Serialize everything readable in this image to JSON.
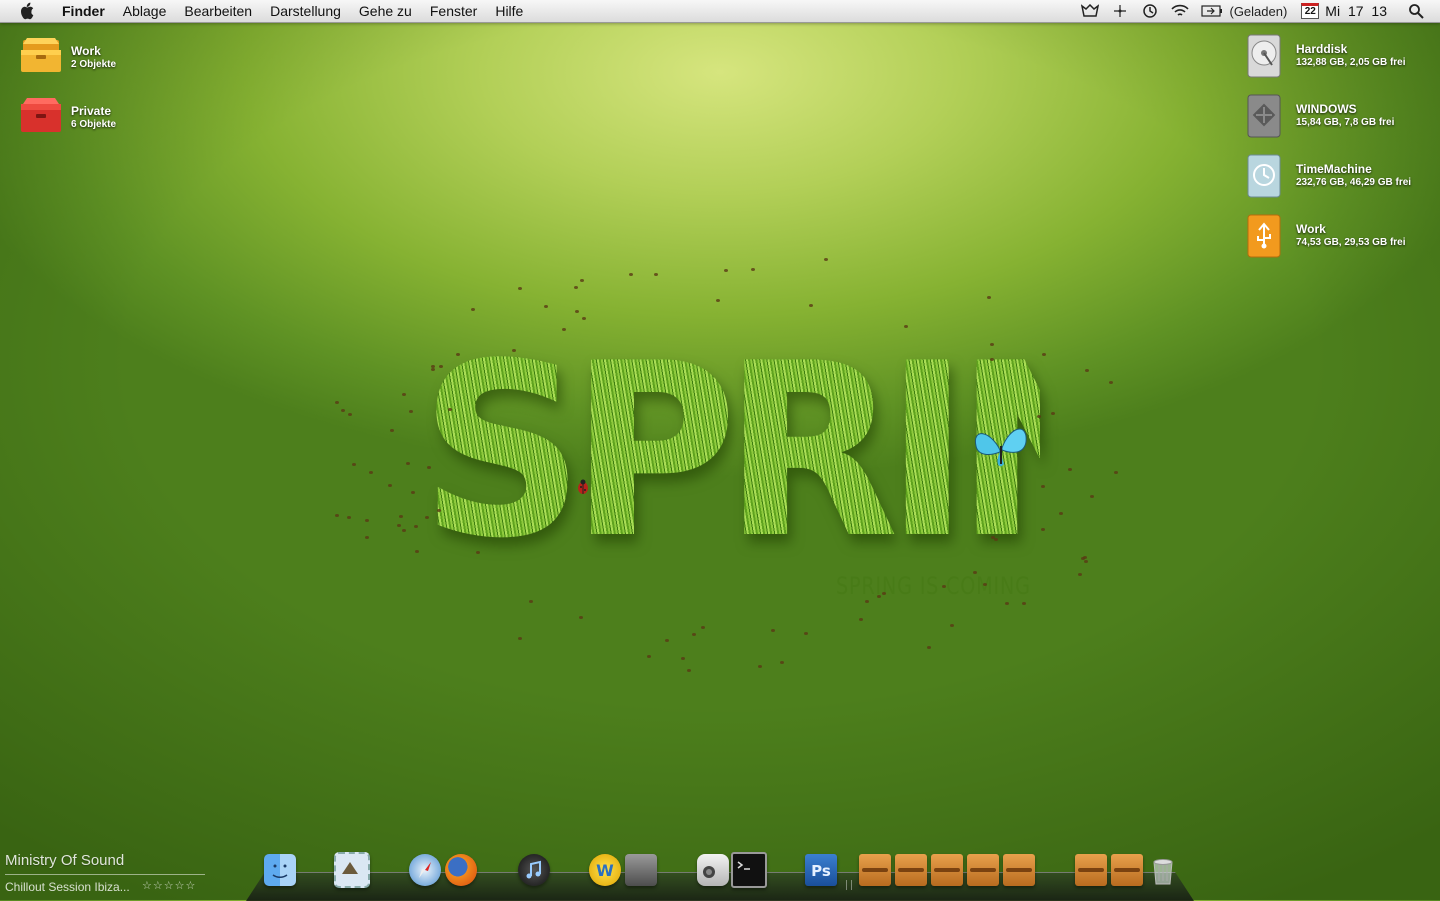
{
  "menubar": {
    "apple_icon": "apple-icon",
    "items": [
      "Finder",
      "Ablage",
      "Bearbeiten",
      "Darstellung",
      "Gehe zu",
      "Fenster",
      "Hilfe"
    ],
    "status": {
      "battery_label": "(Geladen)",
      "calendar_day": "22",
      "clock": "Mi  17 13"
    }
  },
  "desktop_left": [
    {
      "name": "Work",
      "sub": "2 Objekte",
      "color": "#f2b531"
    },
    {
      "name": "Private",
      "sub": "6 Objekte",
      "color": "#d8312c"
    }
  ],
  "desktop_right": [
    {
      "name": "Harddisk",
      "sub": "132,88 GB, 2,05 GB frei"
    },
    {
      "name": "WINDOWS",
      "sub": "15,84 GB, 7,8 GB frei"
    },
    {
      "name": "TimeMachine",
      "sub": "232,76 GB, 46,29 GB frei"
    },
    {
      "name": "Work",
      "sub": "74,53 GB, 29,53 GB frei"
    }
  ],
  "wallpaper": {
    "title": "SPRING",
    "subtitle": "SPRING IS COMING"
  },
  "itunes": {
    "artist": "Ministry Of Sound",
    "album": "Chillout Session Ibiza...",
    "stars": "☆☆☆☆☆"
  },
  "dock": {
    "items": [
      "finder",
      "mail",
      "safari",
      "firefox",
      "itunes",
      "transmit",
      "transmission",
      "camera",
      "terminal",
      "photoshop"
    ],
    "stacks": [
      "stack-1",
      "stack-2",
      "stack-3",
      "stack-4",
      "stack-5",
      "stack-6",
      "stack-7",
      "trash"
    ]
  },
  "colors": {
    "wallpaper_green": "#86b232",
    "menubar": "#e6e6e6",
    "work_folder": "#f2b531",
    "private_folder": "#d8312c",
    "usb_drive": "#f29a1e"
  }
}
